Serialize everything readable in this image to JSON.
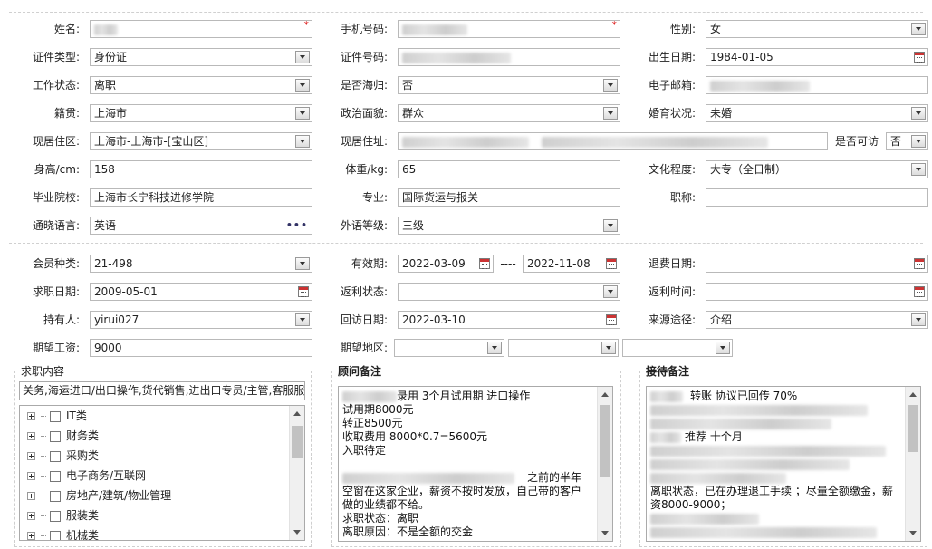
{
  "basic": {
    "name": {
      "label": "姓名:",
      "required": "*"
    },
    "mobile": {
      "label": "手机号码:",
      "required": "*"
    },
    "gender": {
      "label": "性别:",
      "value": "女"
    },
    "id_type": {
      "label": "证件类型:",
      "value": "身份证"
    },
    "id_no": {
      "label": "证件号码:"
    },
    "birth": {
      "label": "出生日期:",
      "value": "1984-01-05"
    },
    "work_status": {
      "label": "工作状态:",
      "value": "离职"
    },
    "returnee": {
      "label": "是否海归:",
      "value": "否"
    },
    "email": {
      "label": "电子邮箱:"
    },
    "native": {
      "label": "籍贯:",
      "value": "上海市"
    },
    "politics": {
      "label": "政治面貌:",
      "value": "群众"
    },
    "marital": {
      "label": "婚育状况:",
      "value": "未婚"
    },
    "residence_area": {
      "label": "现居住区:",
      "value": "上海市-上海市-[宝山区]"
    },
    "address": {
      "label": "现居住址:"
    },
    "visitable": {
      "label": "是否可访",
      "value": "否"
    },
    "height": {
      "label": "身高/cm:",
      "value": "158"
    },
    "weight": {
      "label": "体重/kg:",
      "value": "65"
    },
    "education": {
      "label": "文化程度:",
      "value": "大专（全日制）"
    },
    "school": {
      "label": "毕业院校:",
      "value": "上海市长宁科技进修学院"
    },
    "major": {
      "label": "专业:",
      "value": "国际货运与报关"
    },
    "title": {
      "label": "职称:",
      "value": ""
    },
    "language": {
      "label": "通晓语言:",
      "value": "英语",
      "more": "•••"
    },
    "foreign_level": {
      "label": "外语等级:",
      "value": "三级"
    }
  },
  "member": {
    "type": {
      "label": "会员种类:",
      "value": "21-498"
    },
    "valid": {
      "label": "有效期:",
      "from": "2022-03-09",
      "sep": "----",
      "to": "2022-11-08"
    },
    "refund_date": {
      "label": "退费日期:",
      "value": ""
    },
    "job_date": {
      "label": "求职日期:",
      "value": "2009-05-01"
    },
    "rebate_status": {
      "label": "返利状态:",
      "value": ""
    },
    "rebate_time": {
      "label": "返利时间:",
      "value": ""
    },
    "holder": {
      "label": "持有人:",
      "value": "yirui027"
    },
    "visit_date": {
      "label": "回访日期:",
      "value": "2022-03-10"
    },
    "source": {
      "label": "来源途径:",
      "value": "介绍"
    },
    "salary": {
      "label": "期望工资:",
      "value": "9000"
    },
    "region": {
      "label": "期望地区:"
    }
  },
  "job_content": {
    "title": "求职内容",
    "summary": "关务,海运进口/出口操作,货代销售,进出口专员/主管,客服服",
    "tree": [
      "IT类",
      "财务类",
      "采购类",
      "电子商务/互联网",
      "房地产/建筑/物业管理",
      "服装类",
      "机械类"
    ]
  },
  "advisor_note": {
    "title": "顾问备注",
    "lines": [
      {
        "pre": "",
        "text": "录用    3个月试用期      进口操作"
      },
      {
        "pre": "",
        "text": "试用期8000元"
      },
      {
        "pre": "",
        "text": "转正8500元"
      },
      {
        "pre": "",
        "text": "收取费用  8000*0.7=5600元"
      },
      {
        "pre": "",
        "text": "入职待定"
      },
      {
        "pre": "",
        "text": ""
      },
      {
        "pre": "",
        "text": "之前的半年"
      },
      {
        "pre": "",
        "text": "空窗在这家企业，薪资不按时发放，自己带的客户"
      },
      {
        "pre": "",
        "text": "做的业绩都不给。"
      },
      {
        "pre": "",
        "text": "求职状态：离职"
      },
      {
        "pre": "",
        "text": "离职原因：不是全额的交金"
      }
    ]
  },
  "reception_note": {
    "title": "接待备注",
    "line1": "转账   协议已回传      70%",
    "line2": "推荐  十个月",
    "line3": "离职状态，已在办理退工手续 ；尽量全额缴金，薪",
    "line4": "资8000-9000；"
  }
}
